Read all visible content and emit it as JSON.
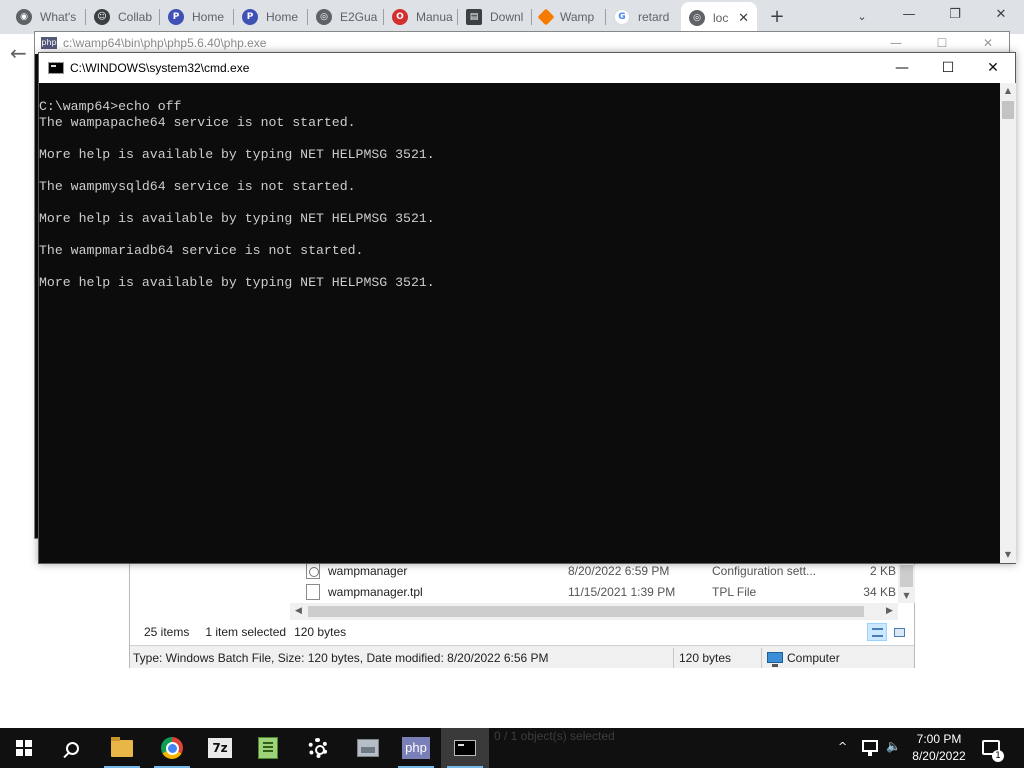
{
  "browser": {
    "tabs": [
      {
        "label": "What's",
        "icon": "chrome-icon",
        "color": "#5f6368"
      },
      {
        "label": "Collab",
        "icon": "user-badge-icon",
        "color": "#3c4043"
      },
      {
        "label": "Home",
        "icon": "pbs-icon",
        "color": "#3f51b5"
      },
      {
        "label": "Home",
        "icon": "pbs-icon",
        "color": "#3f51b5"
      },
      {
        "label": "E2Gua",
        "icon": "globe-icon",
        "color": "#5f6368"
      },
      {
        "label": "Manua",
        "icon": "opera-icon",
        "color": "#d32f2f"
      },
      {
        "label": "Downl",
        "icon": "doc-icon",
        "color": "#3c4043"
      },
      {
        "label": "Wamp",
        "icon": "wamp-icon",
        "color": "#f57c00"
      },
      {
        "label": "retard",
        "icon": "google-icon",
        "color": "#4285f4"
      },
      {
        "label": "loc",
        "icon": "globe-icon",
        "color": "#5f6368",
        "active": true
      }
    ],
    "new_tab": "+",
    "tab_search": "⌄",
    "controls": {
      "minimize": "—",
      "restore": "❐",
      "close": "✕"
    },
    "back": "←"
  },
  "php_window": {
    "icon_text": "php",
    "title": "c:\\wamp64\\bin\\php\\php5.6.40\\php.exe",
    "controls": {
      "minimize": "—",
      "maximize": "☐",
      "close": "✕"
    }
  },
  "cmd_window": {
    "title": "C:\\WINDOWS\\system32\\cmd.exe",
    "controls": {
      "minimize": "—",
      "maximize": "☐",
      "close": "✕"
    },
    "console_lines": [
      "C:\\wamp64>echo off",
      "The wampapache64 service is not started.",
      "",
      "More help is available by typing NET HELPMSG 3521.",
      "",
      "The wampmysqld64 service is not started.",
      "",
      "More help is available by typing NET HELPMSG 3521.",
      "",
      "The wampmariadb64 service is not started.",
      "",
      "More help is available by typing NET HELPMSG 3521."
    ]
  },
  "explorer": {
    "files": [
      {
        "name": "wampmanager",
        "date": "8/20/2022 6:59 PM",
        "type": "Configuration sett...",
        "size": "2 KB"
      },
      {
        "name": "wampmanager.tpl",
        "date": "11/15/2021 1:39 PM",
        "type": "TPL File",
        "size": "34 KB"
      }
    ],
    "status": {
      "count": "25 items",
      "selected": "1 item selected",
      "size": "120 bytes"
    },
    "details": {
      "info": "Type: Windows Batch File, Size: 120 bytes, Date modified: 8/20/2022 6:56 PM",
      "size": "120 bytes",
      "location": "Computer"
    }
  },
  "taskbar": {
    "ghost_text": "0 / 1 object(s) selected",
    "php_label": "php",
    "sevenz_label": "7z",
    "tray_caret": "^",
    "volume": "🔈",
    "time": "7:00 PM",
    "date": "8/20/2022",
    "notification_count": "1"
  }
}
